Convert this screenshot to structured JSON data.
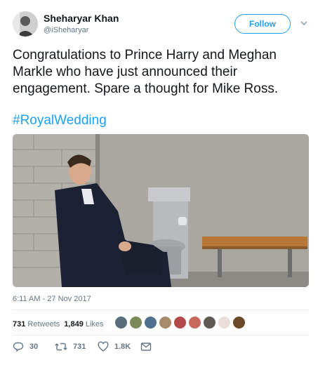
{
  "user": {
    "name": "Sheharyar Khan",
    "handle": "@iSheharyar"
  },
  "follow_label": "Follow",
  "tweet": {
    "text": "Congratulations to Prince Harry and Meghan Markle who have just announced their engagement. Spare a thought for Mike Ross.",
    "hashtag": "#RoyalWedding",
    "timestamp": "6:11 AM - 27 Nov 2017"
  },
  "stats": {
    "retweets_count": "731",
    "retweets_label": "Retweets",
    "likes_count": "1,849",
    "likes_label": "Likes"
  },
  "actions": {
    "replies": "30",
    "retweets": "731",
    "likes": "1.8K"
  },
  "colors": {
    "accent": "#1da1f2",
    "secondary_text": "#657786",
    "divider": "#e6ecf0"
  }
}
